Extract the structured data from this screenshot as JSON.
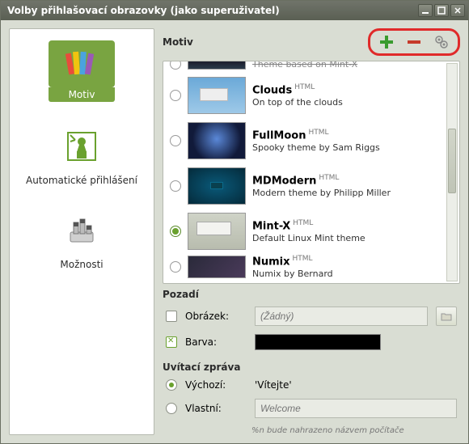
{
  "window": {
    "title": "Volby přihlašovací obrazovky (jako superuživatel)"
  },
  "sidebar": {
    "items": [
      {
        "label": "Motiv"
      },
      {
        "label": "Automatické přihlášení"
      },
      {
        "label": "Možnosti"
      }
    ]
  },
  "sections": {
    "motiv": "Motiv",
    "pozadi": "Pozadí",
    "uvitaci": "Uvítací zpráva"
  },
  "themes": [
    {
      "name": "",
      "desc_partial": "Theme based on Mint-X",
      "tag": "",
      "selected": false,
      "partial": true
    },
    {
      "name": "Clouds",
      "desc": "On top of the clouds",
      "tag": "HTML",
      "selected": false
    },
    {
      "name": "FullMoon",
      "desc": "Spooky theme by Sam Riggs",
      "tag": "HTML",
      "selected": false
    },
    {
      "name": "MDModern",
      "desc": "Modern theme by Philipp Miller",
      "tag": "HTML",
      "selected": false
    },
    {
      "name": "Mint-X",
      "desc": "Default Linux Mint theme",
      "tag": "HTML",
      "selected": true
    },
    {
      "name": "Numix",
      "desc": "Numix by Bernard",
      "tag": "HTML",
      "selected": false,
      "cut": true
    }
  ],
  "background": {
    "obrazek_label": "Obrázek:",
    "obrazek_placeholder": "(Žádný)",
    "barva_label": "Barva:",
    "color": "#000000"
  },
  "greeting": {
    "vychozi_label": "Výchozí:",
    "vychozi_value": "'Vítejte'",
    "vlastni_label": "Vlastní:",
    "vlastni_placeholder": "Welcome",
    "note": "%n bude nahrazeno názvem počítače"
  }
}
